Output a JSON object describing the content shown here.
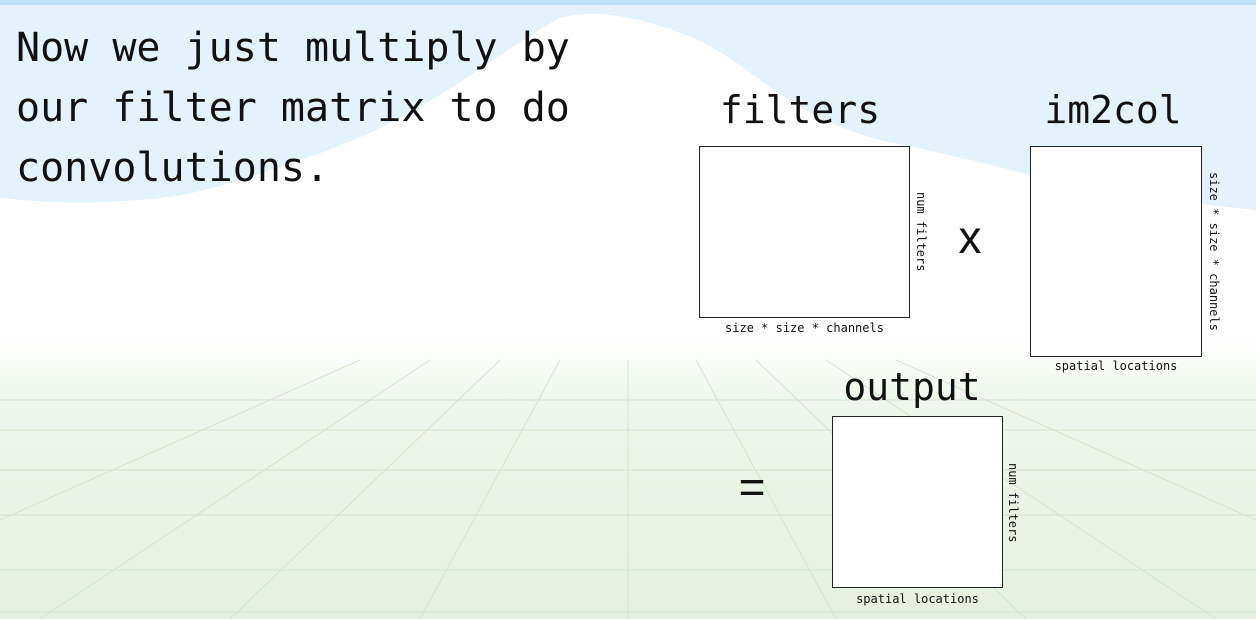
{
  "slide": {
    "text_lines": [
      "Now we just multiply by",
      "our filter matrix to do",
      "convolutions."
    ]
  },
  "diagram": {
    "filters": {
      "title": "filters",
      "bottom_label": "size * size * channels",
      "side_label": "num filters"
    },
    "multiply_symbol": "x",
    "im2col": {
      "title": "im2col",
      "bottom_label": "spatial locations",
      "side_label": "size * size * channels"
    },
    "equals_symbol": "=",
    "output": {
      "title": "output",
      "bottom_label": "spatial locations",
      "side_label": "num filters"
    }
  },
  "theme": {
    "sky": "#e4f2fb",
    "mountain": "#ffffff",
    "ground": "#e8f4e4",
    "grid_line": "#c9dfc4",
    "top_border": "#bfe0f7",
    "text": "#111111"
  }
}
